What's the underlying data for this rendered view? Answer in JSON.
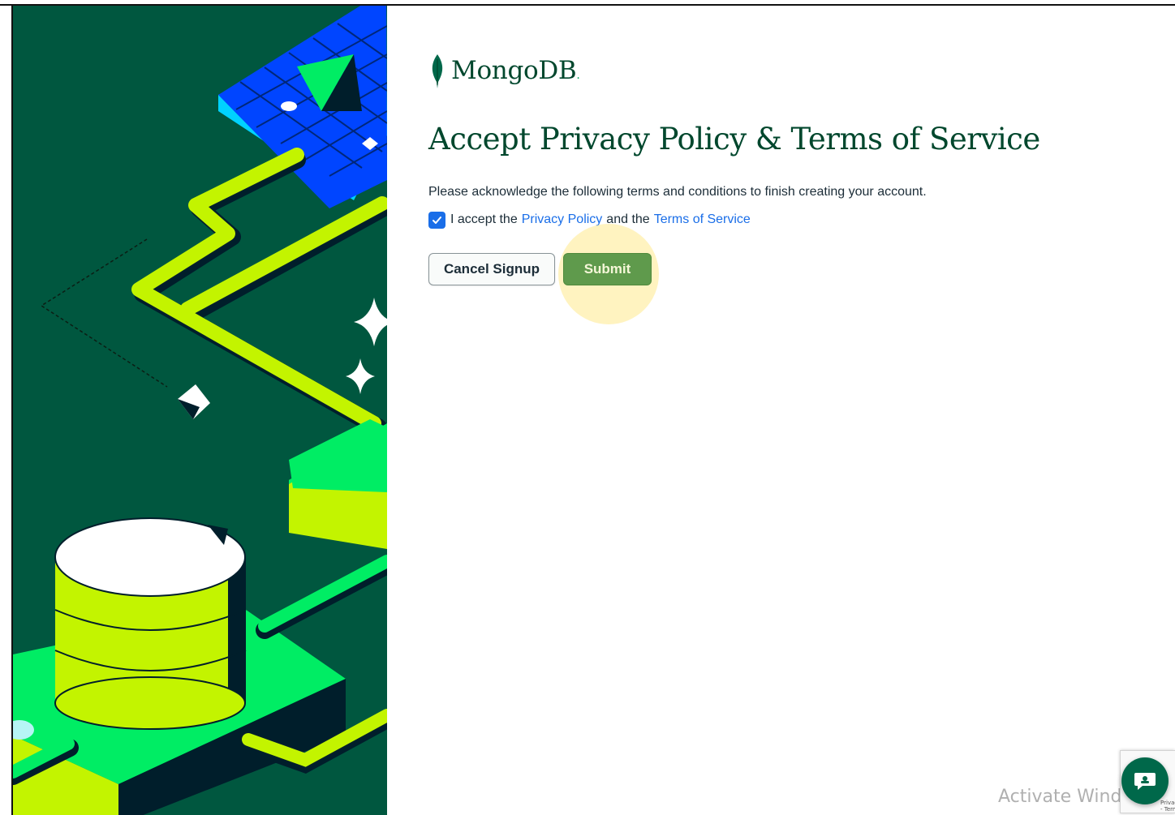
{
  "brand": {
    "name": "MongoDB",
    "dot": ".",
    "leaf_color": "#00684a",
    "text_color": "#00472d"
  },
  "page": {
    "title": "Accept Privacy Policy & Terms of Service",
    "description": "Please acknowledge the following terms and conditions to finish creating your account."
  },
  "consent": {
    "checked": true,
    "prefix": "I accept the",
    "privacy_link": "Privacy Policy",
    "middle": "and the",
    "terms_link": "Terms of Service",
    "link_color": "#1a6ee8"
  },
  "actions": {
    "cancel_label": "Cancel Signup",
    "submit_label": "Submit",
    "submit_color": "#5f9a4c"
  },
  "overlay": {
    "watermark": "Activate Windows",
    "recaptcha_text": "Privacy - Terms",
    "chat_icon": "chat-icon"
  },
  "illustration": {
    "background": "#00573f",
    "accent_green": "#00ed64",
    "lime": "#c3f400",
    "blue": "#0045ff",
    "cyan": "#00d2ff"
  }
}
